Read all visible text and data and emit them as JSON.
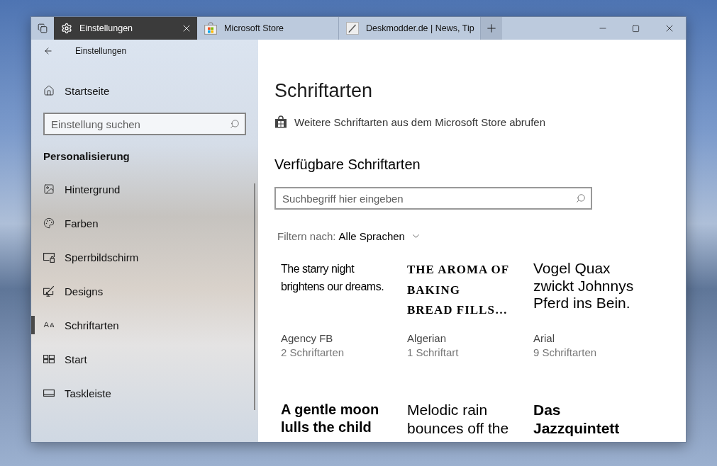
{
  "window": {
    "tabs": [
      {
        "label": "Einstellungen",
        "kind": "settings",
        "selected": true
      },
      {
        "label": "Microsoft Store",
        "kind": "store",
        "selected": false
      },
      {
        "label": "Deskmodder.de | News, Tip",
        "kind": "web",
        "selected": false
      }
    ]
  },
  "sidebar": {
    "back_label": "Einstellungen",
    "home": "Startseite",
    "search": {
      "placeholder": "Einstellung suchen"
    },
    "section": "Personalisierung",
    "items": [
      {
        "label": "Hintergrund",
        "kind": "background",
        "selected": false
      },
      {
        "label": "Farben",
        "kind": "colors",
        "selected": false
      },
      {
        "label": "Sperrbildschirm",
        "kind": "lockscreen",
        "selected": false
      },
      {
        "label": "Designs",
        "kind": "themes",
        "selected": false
      },
      {
        "label": "Schriftarten",
        "kind": "fonts",
        "selected": true
      },
      {
        "label": "Start",
        "kind": "start",
        "selected": false
      },
      {
        "label": "Taskleiste",
        "kind": "taskbar",
        "selected": false
      }
    ]
  },
  "content": {
    "title": "Schriftarten",
    "store_link": "Weitere Schriftarten aus dem Microsoft Store abrufen",
    "section_title": "Verfügbare Schriftarten",
    "search": {
      "placeholder": "Suchbegriff hier eingeben"
    },
    "filter": {
      "label": "Filtern nach:",
      "value": "Alle Sprachen"
    },
    "fonts": [
      {
        "sample": "The starry night brightens our dreams.",
        "kind": "condensed",
        "name": "Agency FB",
        "count": "2 Schriftarten"
      },
      {
        "sample": "THE AROMA OF\nBAKING\nBREAD FILLS…",
        "kind": "decorative",
        "name": "Algerian",
        "count": "1 Schriftart"
      },
      {
        "sample": "Vogel Quax zwickt Johnnys Pferd ins Bein.",
        "kind": "sans",
        "name": "Arial",
        "count": "9 Schriftarten"
      },
      {
        "sample": "A gentle moon lulls the child",
        "kind": "bold"
      },
      {
        "sample": "Melodic rain bounces off the",
        "kind": "regular"
      },
      {
        "sample": "Das Jazzquintett",
        "kind": "semibold"
      }
    ]
  }
}
